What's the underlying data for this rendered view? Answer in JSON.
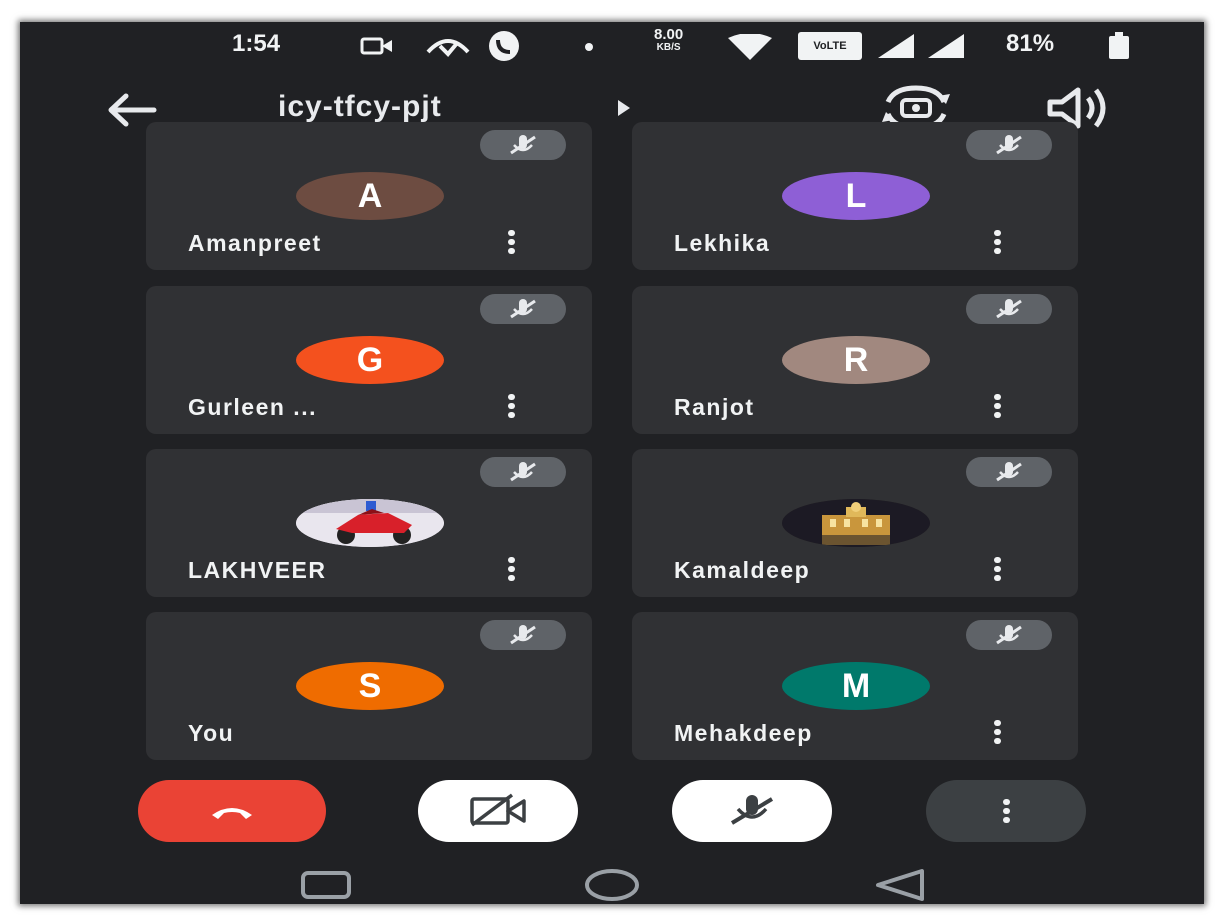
{
  "status_bar": {
    "time": "1:54",
    "speed_value": "8.00",
    "speed_unit": "KB/S",
    "volte_label": "VoLTE",
    "battery": "81%"
  },
  "top_bar": {
    "meeting_code": "icy-tfcy-pjt",
    "icons": [
      "back-arrow-icon",
      "caret-right-icon",
      "switch-camera-icon",
      "speaker-icon"
    ]
  },
  "participants": [
    {
      "name": "Amanpreet",
      "initial": "A",
      "avatar_color": "#6d4c41",
      "muted": true
    },
    {
      "name": "Lekhika",
      "initial": "L",
      "avatar_color": "#8e5fd6",
      "muted": true
    },
    {
      "name": "Gurleen ...",
      "initial": "G",
      "avatar_color": "#f4511e",
      "muted": true
    },
    {
      "name": "Ranjot",
      "initial": "R",
      "avatar_color": "#a1887f",
      "muted": true
    },
    {
      "name": "LAKHVEER",
      "initial": "",
      "avatar_color": "#e8e8ee",
      "photo": "red-motorbike-photo",
      "muted": true
    },
    {
      "name": "Kamaldeep",
      "initial": "",
      "avatar_color": "#2a2620",
      "photo": "golden-temple-night-photo",
      "muted": true
    },
    {
      "name": "You",
      "initial": "S",
      "avatar_color": "#ef6c00",
      "muted": true
    },
    {
      "name": "Mehakdeep",
      "initial": "M",
      "avatar_color": "#00796b",
      "muted": true
    }
  ],
  "controls": {
    "end_call_color": "#ea4335",
    "camera_state": "off",
    "mic_state": "muted",
    "icons": [
      "end-call-icon",
      "camera-off-icon",
      "mic-off-icon",
      "more-options-icon"
    ]
  },
  "nav_bar": {
    "icons": [
      "recent-apps-icon",
      "home-icon",
      "back-triangle-icon"
    ]
  }
}
